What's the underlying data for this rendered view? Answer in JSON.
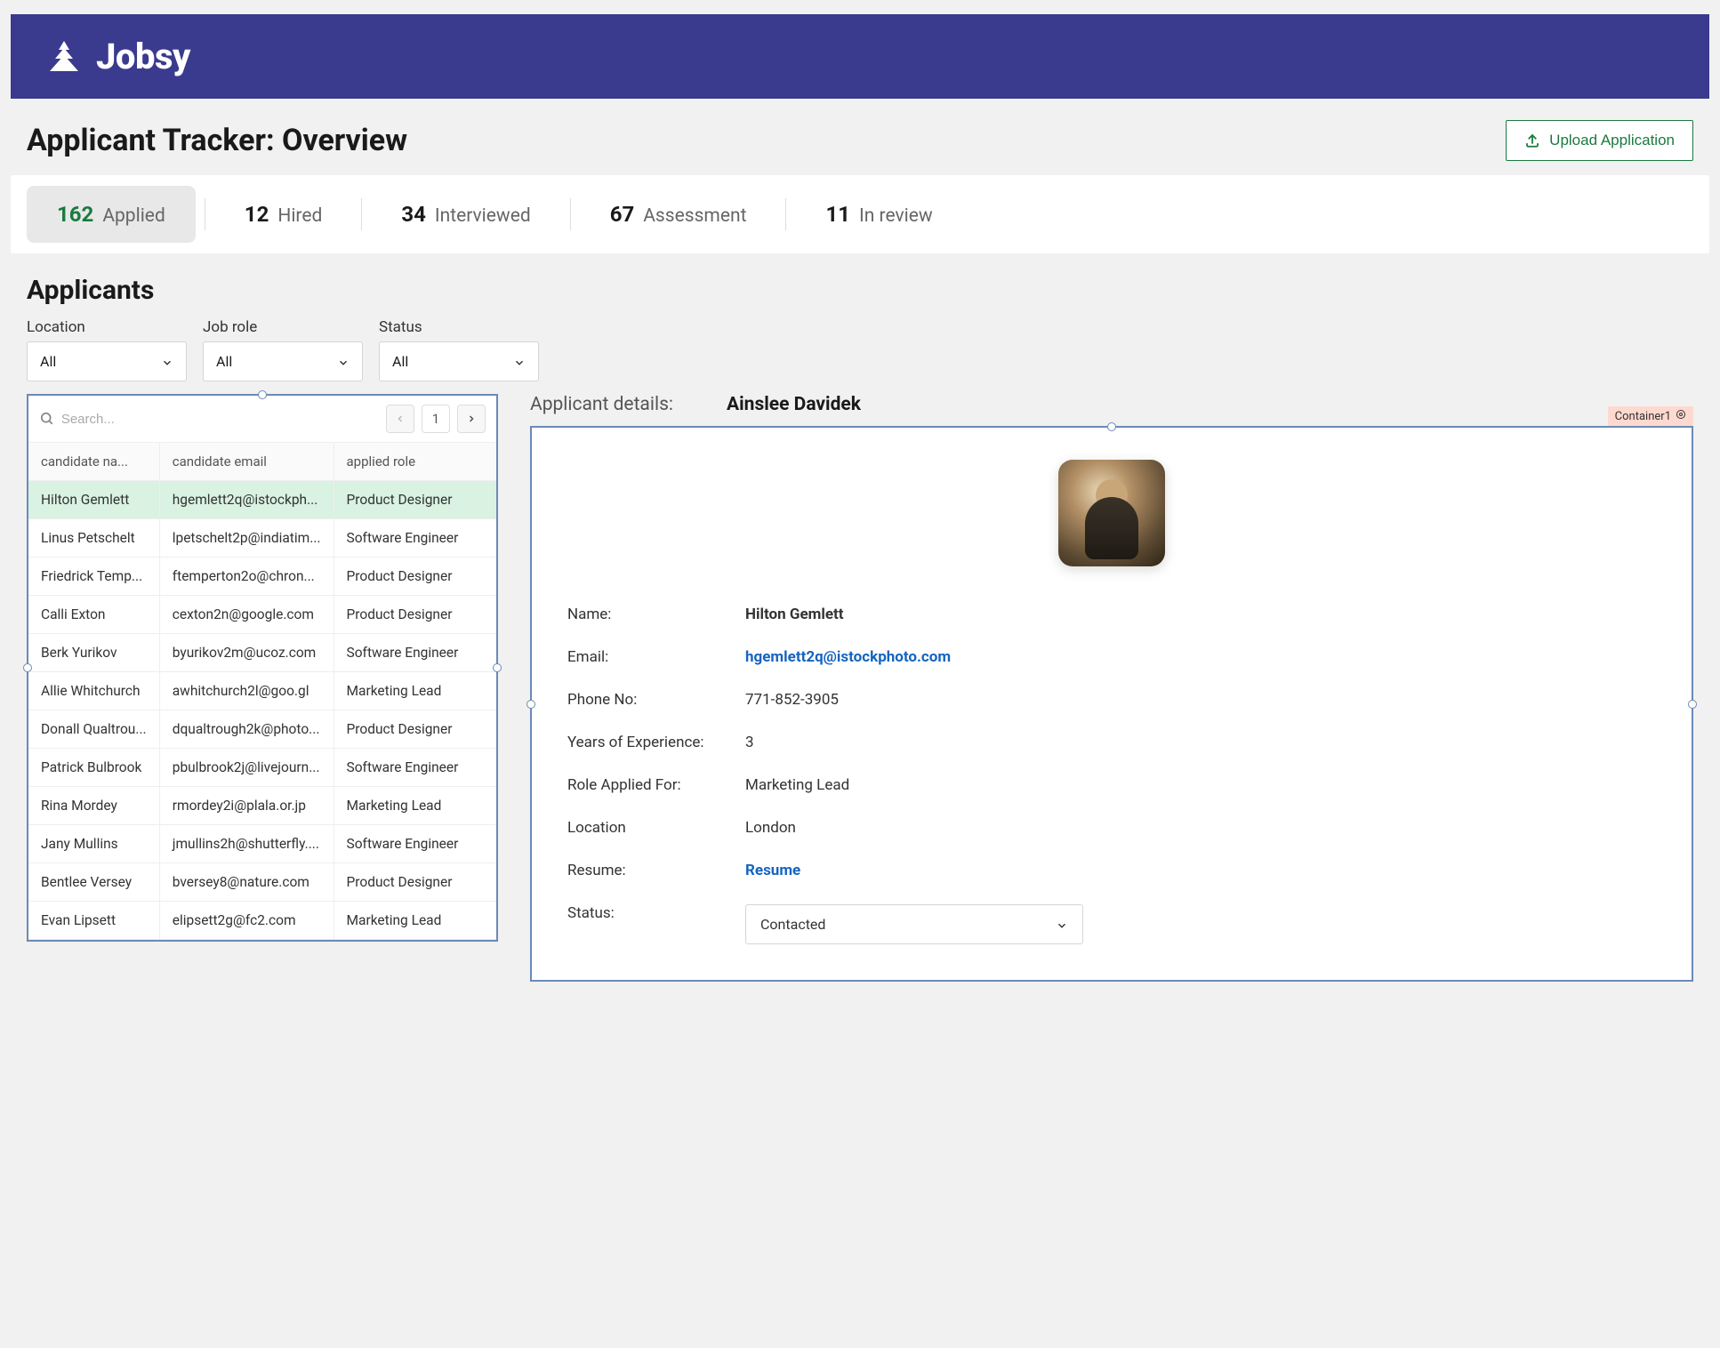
{
  "brand": {
    "name": "Jobsy"
  },
  "page_title": "Applicant Tracker: Overview",
  "upload_button": "Upload Application",
  "stats": [
    {
      "count": "162",
      "label": "Applied",
      "active": true
    },
    {
      "count": "12",
      "label": "Hired"
    },
    {
      "count": "34",
      "label": "Interviewed"
    },
    {
      "count": "67",
      "label": "Assessment"
    },
    {
      "count": "11",
      "label": "In review"
    }
  ],
  "applicants_heading": "Applicants",
  "filters": {
    "location": {
      "label": "Location",
      "value": "All"
    },
    "job_role": {
      "label": "Job role",
      "value": "All"
    },
    "status": {
      "label": "Status",
      "value": "All"
    }
  },
  "search_placeholder": "Search...",
  "pagination": {
    "page": "1"
  },
  "container_tag": "Container1",
  "table": {
    "headers": {
      "name": "candidate na...",
      "email": "candidate email",
      "role": "applied role"
    },
    "rows": [
      {
        "name": "Hilton Gemlett",
        "email": "hgemlett2q@istockph...",
        "role": "Product Designer",
        "selected": true
      },
      {
        "name": "Linus Petschelt",
        "email": "lpetschelt2p@indiatim...",
        "role": "Software Engineer"
      },
      {
        "name": "Friedrick Temp...",
        "email": "ftemperton2o@chron...",
        "role": "Product Designer"
      },
      {
        "name": "Calli Exton",
        "email": "cexton2n@google.com",
        "role": "Product Designer"
      },
      {
        "name": "Berk Yurikov",
        "email": "byurikov2m@ucoz.com",
        "role": "Software Engineer"
      },
      {
        "name": "Allie Whitchurch",
        "email": "awhitchurch2l@goo.gl",
        "role": "Marketing Lead"
      },
      {
        "name": "Donall Qualtrou...",
        "email": "dqualtrough2k@photo...",
        "role": "Product Designer"
      },
      {
        "name": "Patrick Bulbrook",
        "email": "pbulbrook2j@livejourn...",
        "role": "Software Engineer"
      },
      {
        "name": "Rina Mordey",
        "email": "rmordey2i@plala.or.jp",
        "role": "Marketing Lead"
      },
      {
        "name": "Jany Mullins",
        "email": "jmullins2h@shutterfly....",
        "role": "Software Engineer"
      },
      {
        "name": "Bentlee Versey",
        "email": "bversey8@nature.com",
        "role": "Product Designer"
      },
      {
        "name": "Evan Lipsett",
        "email": "elipsett2g@fc2.com",
        "role": "Marketing Lead"
      }
    ]
  },
  "details_header": {
    "label": "Applicant details:",
    "name": "Ainslee Davidek"
  },
  "details": {
    "name": {
      "label": "Name:",
      "value": "Hilton Gemlett"
    },
    "email": {
      "label": "Email:",
      "value": "hgemlett2q@istockphoto.com"
    },
    "phone": {
      "label": "Phone No:",
      "value": "771-852-3905"
    },
    "yoe": {
      "label": "Years of Experience:",
      "value": "3"
    },
    "role": {
      "label": "Role Applied For:",
      "value": "Marketing Lead"
    },
    "location": {
      "label": "Location",
      "value": "London"
    },
    "resume": {
      "label": "Resume:",
      "value": "Resume"
    },
    "status": {
      "label": "Status:",
      "value": "Contacted"
    }
  }
}
